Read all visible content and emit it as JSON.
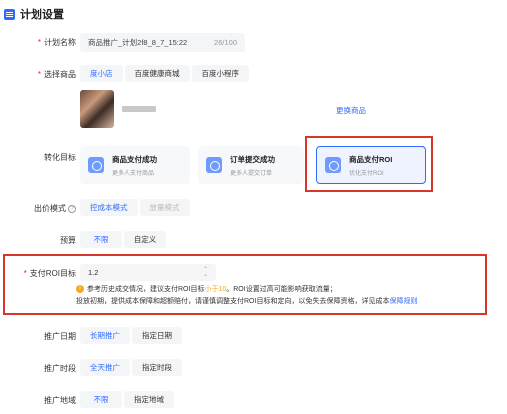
{
  "header": {
    "title": "计划设置"
  },
  "plan_name": {
    "label": "计划名称",
    "value": "商品推广_计划2f8_8_7_15:22",
    "count": "26/100"
  },
  "product": {
    "label": "选择商品",
    "tabs": [
      "度小店",
      "百度健康商城",
      "百度小程序"
    ],
    "swap_link": "更换商品"
  },
  "conversion": {
    "label": "转化目标",
    "cards": [
      {
        "title": "商品支付成功",
        "sub": "更多人支付商品"
      },
      {
        "title": "订单提交成功",
        "sub": "更多人提交订单"
      },
      {
        "title": "商品支付ROI",
        "sub": "优化支付ROI"
      }
    ]
  },
  "bid_mode": {
    "label": "出价模式",
    "options": [
      "控成本模式",
      "放量模式"
    ]
  },
  "budget": {
    "label": "预算",
    "options": [
      "不限",
      "自定义"
    ]
  },
  "roi": {
    "label": "支付ROI目标",
    "value": "1.2",
    "tip_prefix": "参考历史成交情况，建议支付ROI目标",
    "tip_highlight": "小于10",
    "tip_suffix": "。ROI设置过高可能影响获取流量；",
    "tip_line2": "投放初期，提供成本保障和超额赔付，请谨慎调整支付ROI目标和定向，以免失去保障资格，详见成本",
    "tip_link": "保障规则"
  },
  "date": {
    "label": "推广日期",
    "options": [
      "长期推广",
      "指定日期"
    ]
  },
  "time": {
    "label": "推广时段",
    "options": [
      "全天推广",
      "指定时段"
    ]
  },
  "region": {
    "label": "推广地域",
    "options": [
      "不限",
      "指定地域"
    ]
  },
  "colors": {
    "accent": "#2f6bff",
    "highlight_box": "#d8352b",
    "warning": "#f5a623"
  }
}
